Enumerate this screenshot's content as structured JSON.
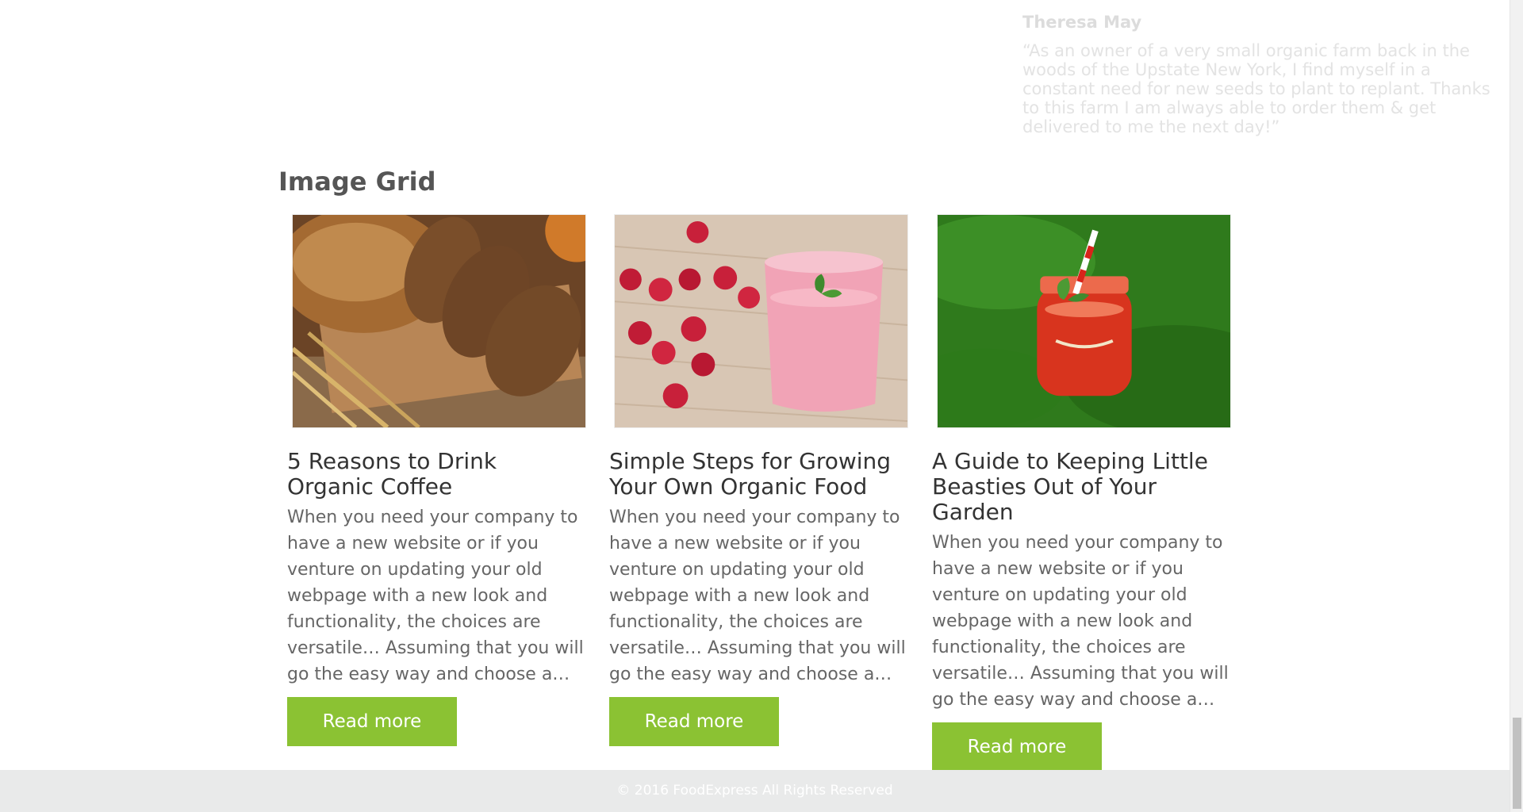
{
  "testimonial": {
    "name": "Theresa May",
    "quote": "“As an owner of a very small organic farm back in the woods of the Upstate New York, I find myself in a constant need for new seeds to plant to replant. Thanks to this farm I am always able to order them & get delivered to me the next day!”"
  },
  "section": {
    "title": "Image Grid"
  },
  "cards": [
    {
      "image": "bread-loaves-image",
      "title": "5 Reasons to Drink Organic Coffee",
      "excerpt": "When you need your company to have a new website or if you venture on updating your old webpage with a new look and functionality, the choices are versatile… Assuming that you will go the easy way and choose a…",
      "button": "Read more"
    },
    {
      "image": "raspberry-smoothie-image",
      "title": "Simple Steps for Growing Your Own Organic Food",
      "excerpt": "When you need your company to have a new website or if you venture on updating your old webpage with a new look and functionality, the choices are versatile… Assuming that you will go the easy way and choose a…",
      "button": "Read more"
    },
    {
      "image": "red-juice-jar-image",
      "title": "A Guide to Keeping Little Beasties Out of Your Garden",
      "excerpt": "When you need your company to have a new website or if you venture on updating your old webpage with a new look and functionality, the choices are versatile… Assuming that you will go the easy way and choose a…",
      "button": "Read more"
    }
  ],
  "footer": {
    "copyright": "© 2016 FoodExpress All Rights Reserved"
  },
  "colors": {
    "accent": "#8bc233",
    "footer_bg": "#e9eaea"
  }
}
